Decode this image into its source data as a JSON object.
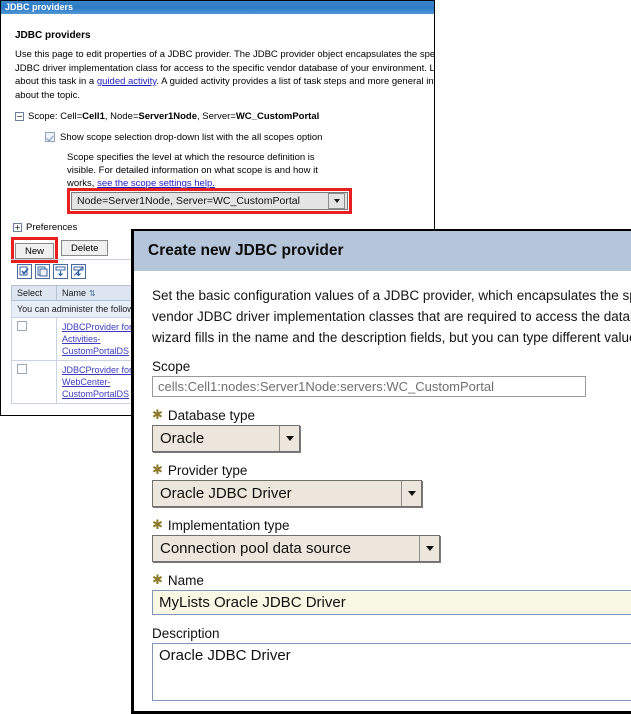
{
  "console": {
    "titlebar": "JDBC providers",
    "page_heading": "JDBC providers",
    "description_lines": [
      "Use this page to edit properties of a JDBC provider. The JDBC provider object encapsulates the specific",
      "JDBC driver implementation class for access to the specific vendor database of your environment. Learn more",
      "about this task in a ",
      ". A guided activity provides a list of task steps and more general information",
      "about the topic."
    ],
    "guided_activity_link": "guided activity",
    "scope": {
      "expander": "−",
      "prefix": "Scope: Cell=",
      "cell": "Cell1",
      "node_label": ", Node=",
      "node": "Server1Node",
      "server_label": ", Server=",
      "server": "WC_CustomPortal",
      "checkbox_label": "Show scope selection drop-down list with the all scopes option",
      "help_lines": [
        "Scope specifies the level at which the resource definition is",
        "visible. For detailed information on what scope is and how it",
        "works, "
      ],
      "help_link": "see the scope settings help.",
      "selected_scope": "Node=Server1Node, Server=WC_CustomPortal"
    },
    "preferences": {
      "expander": "+",
      "label": "Preferences"
    },
    "buttons": {
      "new": "New",
      "delete": "Delete"
    },
    "toolbar_icons": [
      "select-all-icon",
      "deselect-all-icon",
      "show-filter-rows-icon",
      "hide-filter-rows-icon"
    ],
    "table": {
      "headers": [
        "Select",
        "Name"
      ],
      "sort_glyph": "⇅",
      "note_row": "You can administer the following resources:",
      "rows": [
        {
          "name_lines": [
            "JDBCProvider for",
            "Activities-",
            "CustomPortalDS"
          ]
        },
        {
          "name_lines": [
            "JDBCProvider for",
            "WebCenter-",
            "CustomPortalDS"
          ]
        }
      ]
    }
  },
  "dialog": {
    "title": "Create new JDBC provider",
    "intro_lines": [
      "Set the basic configuration values of a JDBC provider, which encapsulates the specific",
      "vendor JDBC driver implementation classes that are required to access the database. The",
      "wizard fills in the name and the description fields, but you can type different values."
    ],
    "fields": {
      "scope": {
        "label": "Scope",
        "value": "cells:Cell1:nodes:Server1Node:servers:WC_CustomPortal",
        "required": false
      },
      "database_type": {
        "label": "Database type",
        "value": "Oracle",
        "required": true,
        "required_marker": "✱"
      },
      "provider_type": {
        "label": "Provider type",
        "value": "Oracle JDBC Driver",
        "required": true,
        "required_marker": "✱"
      },
      "implementation_type": {
        "label": "Implementation type",
        "value": "Connection pool data source",
        "required": true,
        "required_marker": "✱"
      },
      "name": {
        "label": "Name",
        "value": "MyLists Oracle JDBC Driver",
        "required": true,
        "required_marker": "✱"
      },
      "description": {
        "label": "Description",
        "value": "Oracle JDBC Driver",
        "required": false
      }
    }
  },
  "colors": {
    "titlebar_blue": "#3a86cc",
    "dialog_header": "#b6c6da",
    "highlight_red": "#e81f1f",
    "link_blue": "#2020c0",
    "required_star": "#8d7a2a",
    "input_yellow": "#f8f8e4",
    "select_beige": "#ece6dd"
  }
}
